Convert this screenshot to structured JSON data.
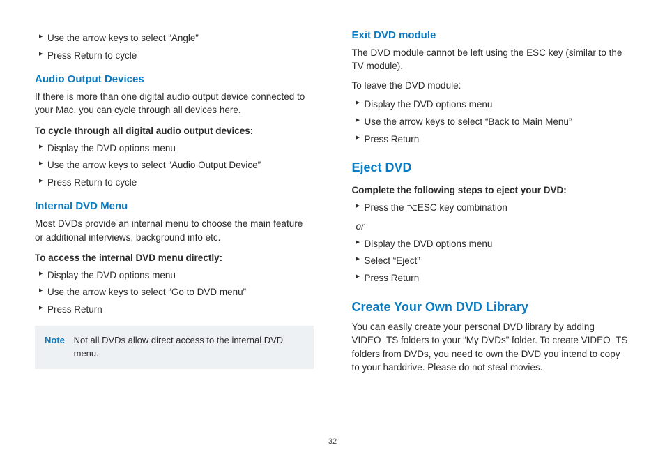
{
  "col1": {
    "top_bullets": [
      "Use the arrow keys to select “Angle”",
      "Press Return to cycle"
    ],
    "audio": {
      "heading": "Audio Output Devices",
      "body": "If there is more than one digital audio output device connected to your Mac, you can cycle through all devices here.",
      "intro": "To cycle through all digital audio output devices:",
      "steps": [
        "Display the DVD options menu",
        "Use the arrow keys to select “Audio Output Device”",
        "Press Return to cycle"
      ]
    },
    "internal": {
      "heading": "Internal DVD Menu",
      "body": "Most DVDs provide an internal menu to choose the main feature or additional interviews, background info etc.",
      "intro": "To access the internal DVD menu directly:",
      "steps": [
        "Display the DVD options menu",
        "Use the arrow keys to select “Go to DVD menu”",
        "Press Return"
      ]
    },
    "note": {
      "label": "Note",
      "text": "Not all DVDs allow direct access to the internal DVD menu."
    }
  },
  "col2": {
    "exit": {
      "heading": "Exit DVD module",
      "body": "The DVD module cannot be left using the ESC key (similar to the TV module).",
      "intro_plain": "To leave the DVD module:",
      "steps": [
        "Display the DVD options menu",
        "Use the arrow keys to select “Back to Main Menu”",
        "Press Return"
      ]
    },
    "eject": {
      "heading": "Eject DVD",
      "intro": "Complete the following steps to eject your DVD:",
      "step_a_prefix": "Press the ",
      "step_a_key": "⌥",
      "step_a_suffix": "ESC key combination",
      "or": "or",
      "steps_b": [
        "Display the DVD options menu",
        "Select “Eject”",
        "Press Return"
      ]
    },
    "library": {
      "heading": "Create Your Own DVD Library",
      "body": "You can easily create your personal DVD library by adding VIDEO_TS folders to your “My DVDs” folder. To create VIDEO_TS folders from DVDs, you need to own the DVD you intend to copy to your harddrive. Please do not steal movies."
    }
  },
  "page_number": "32"
}
